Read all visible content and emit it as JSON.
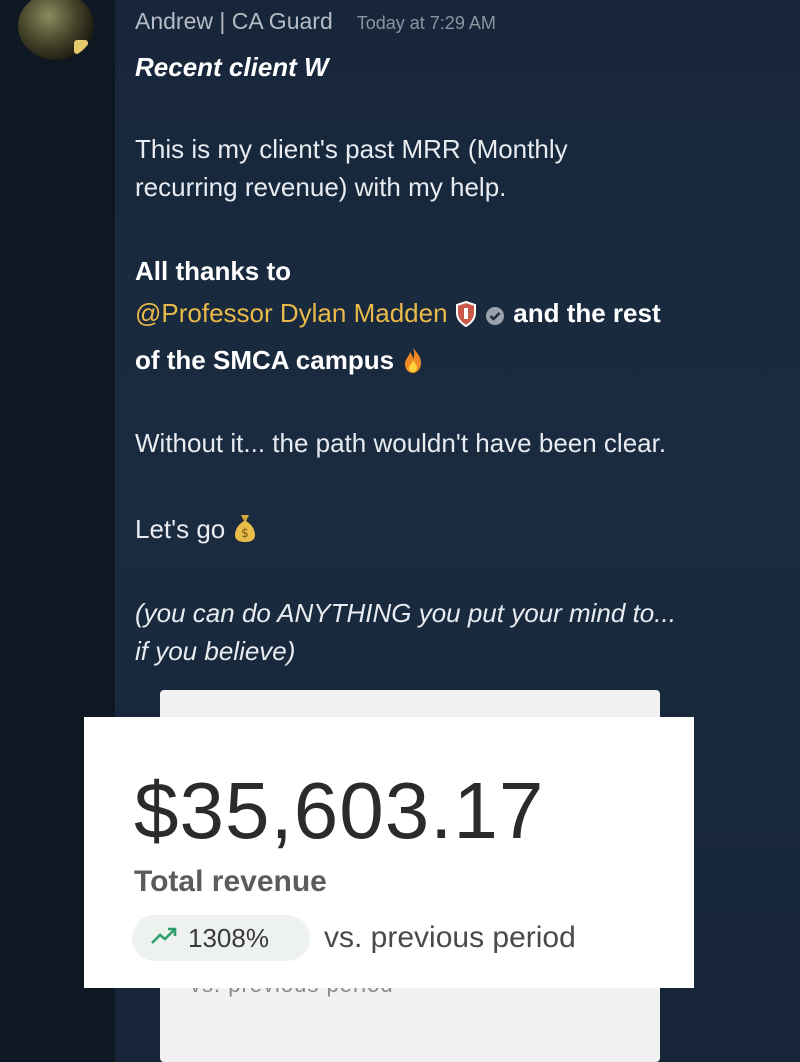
{
  "author": {
    "name": "Andrew | CA Guard",
    "timestamp": "Today at 7:29 AM"
  },
  "message": {
    "title": "Recent client W",
    "line1": "This is my client's past MRR (Monthly",
    "line2": "recurring revenue) with my help.",
    "thanks_prefix": "All thanks to",
    "mention": "@Professor Dylan Madden",
    "thanks_suffix": "and the rest",
    "thanks_line3": "of the SMCA campus",
    "without": "Without it... the path wouldn't have been clear.",
    "lets_go": "Let's go",
    "italic_line1": "(you can do ANYTHING you put your mind to...",
    "italic_line2": "if you believe)"
  },
  "revenue_card": {
    "amount": "$35,603.17",
    "label": "Total revenue",
    "change_pct": "1308%",
    "comparison": "vs. previous period",
    "back_text": "vs. previous period"
  },
  "colors": {
    "mention": "#e9b949",
    "trend_icon": "#2e9e6b"
  },
  "icons": [
    "shield-icon",
    "verified-badge-icon",
    "fire-emoji-icon",
    "money-bag-emoji-icon",
    "trend-up-icon"
  ]
}
